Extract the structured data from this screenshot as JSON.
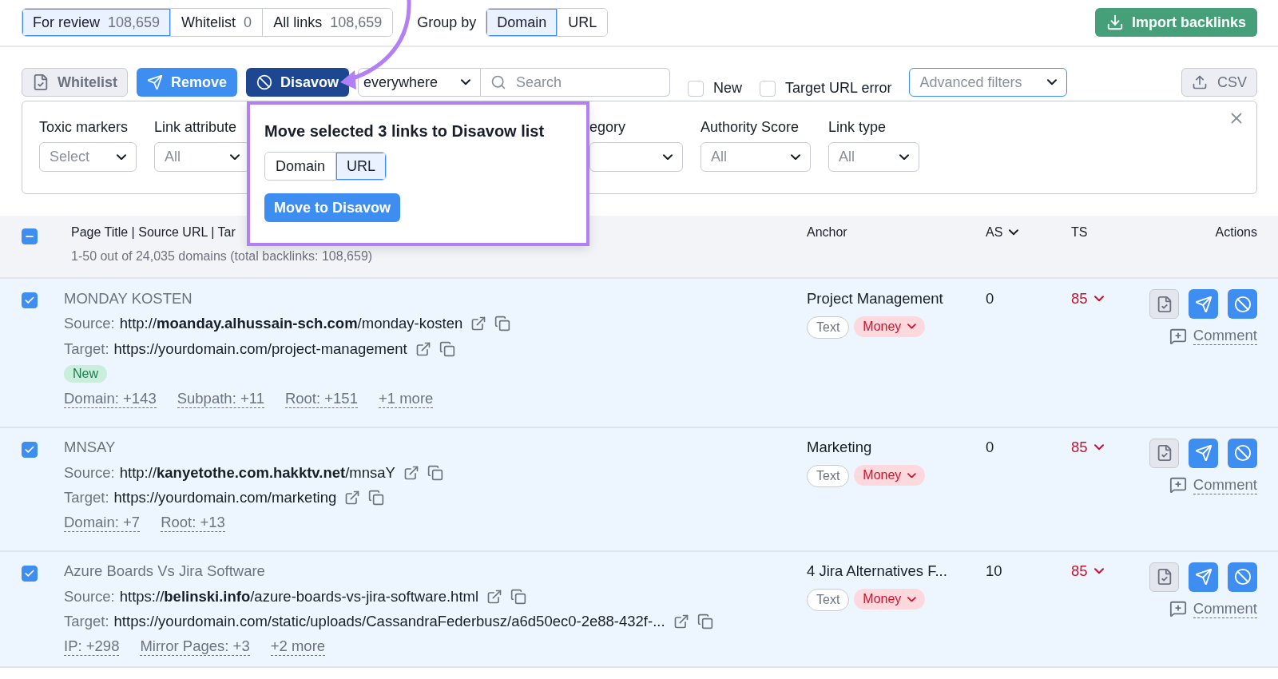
{
  "top_tabs": [
    {
      "label": "For review",
      "count": "108,659",
      "selected": true
    },
    {
      "label": "Whitelist",
      "count": "0",
      "selected": false
    },
    {
      "label": "All links",
      "count": "108,659",
      "selected": false
    }
  ],
  "group_by": {
    "label": "Group by",
    "options": [
      {
        "label": "Domain",
        "selected": true
      },
      {
        "label": "URL",
        "selected": false
      }
    ]
  },
  "import_button": "Import backlinks",
  "toolbar": {
    "buttons": [
      {
        "kind": "whitelist",
        "label": "Whitelist"
      },
      {
        "kind": "remove",
        "label": "Remove"
      },
      {
        "kind": "disavow",
        "label": "Disavow"
      }
    ],
    "scope": "everywhere",
    "search": {
      "placeholder": "Search"
    },
    "checkboxes": [
      {
        "label": "New",
        "checked": false
      },
      {
        "label": "Target URL error",
        "checked": false
      }
    ],
    "advanced_filters": "Advanced filters",
    "export_button": "CSV"
  },
  "filters": [
    {
      "label": "Toxic markers",
      "value": "Select"
    },
    {
      "label": "Link attribute",
      "value": "All"
    },
    {
      "label": "egory"
    },
    {
      "label": "Authority Score",
      "value": "All"
    },
    {
      "label": "Link type",
      "value": "All"
    }
  ],
  "popover": {
    "title": "Move selected 3 links to Disavow list",
    "options": [
      {
        "label": "Domain",
        "selected": false
      },
      {
        "label": "URL",
        "selected": true
      }
    ],
    "button": "Move to Disavow"
  },
  "table": {
    "select_all": {
      "indeterminate": true
    },
    "columns": [
      "Page Title | Source URL | Tar",
      "Anchor",
      "AS",
      "TS",
      "Actions"
    ],
    "summary": "1-50 out of 24,035 domains (total backlinks: 108,659)",
    "rows": [
      {
        "checked": true,
        "title": "MONDAY KOSTEN",
        "source_label": "Source:",
        "target_label": "Target:",
        "source": "http://**moanday.alhussain-sch.com**/monday-kosten",
        "target": "https://yourdomain.com/project-management",
        "is_new": true,
        "new_label": "New",
        "metrics": [
          "Domain: +143",
          "Subpath: +11",
          "Root: +151",
          "+1 more"
        ],
        "anchor": "Project Management",
        "tags": [
          {
            "kind": "type",
            "label": "Text"
          },
          {
            "kind": "category",
            "label": "Money"
          }
        ],
        "as": "0",
        "ts": "85",
        "comment": "Comment"
      },
      {
        "checked": true,
        "title": "MNSAY",
        "source_label": "Source:",
        "target_label": "Target:",
        "source": "http://**kanyetothe.com.hakktv.net**/mnsaY",
        "target": "https://yourdomain.com/marketing",
        "is_new": false,
        "metrics": [
          "Domain: +7",
          "Root: +13"
        ],
        "anchor": "Marketing",
        "tags": [
          {
            "kind": "type",
            "label": "Text"
          },
          {
            "kind": "category",
            "label": "Money"
          }
        ],
        "as": "0",
        "ts": "85",
        "comment": "Comment"
      },
      {
        "checked": true,
        "title": "Azure Boards Vs Jira Software",
        "source_label": "Source:",
        "target_label": "Target:",
        "source": "https://**belinski.info**/azure-boards-vs-jira-software.html",
        "target": "https://yourdomain.com/static/uploads/CassandraFederbusz/a6d50ec0-2e88-432f-...",
        "is_new": false,
        "metrics": [
          "IP: +298",
          "Mirror Pages: +3",
          "+2 more"
        ],
        "anchor": "4 Jira Alternatives F...",
        "tags": [
          {
            "kind": "type",
            "label": "Text"
          },
          {
            "kind": "category",
            "label": "Money"
          }
        ],
        "as": "10",
        "ts": "85",
        "comment": "Comment"
      }
    ]
  }
}
